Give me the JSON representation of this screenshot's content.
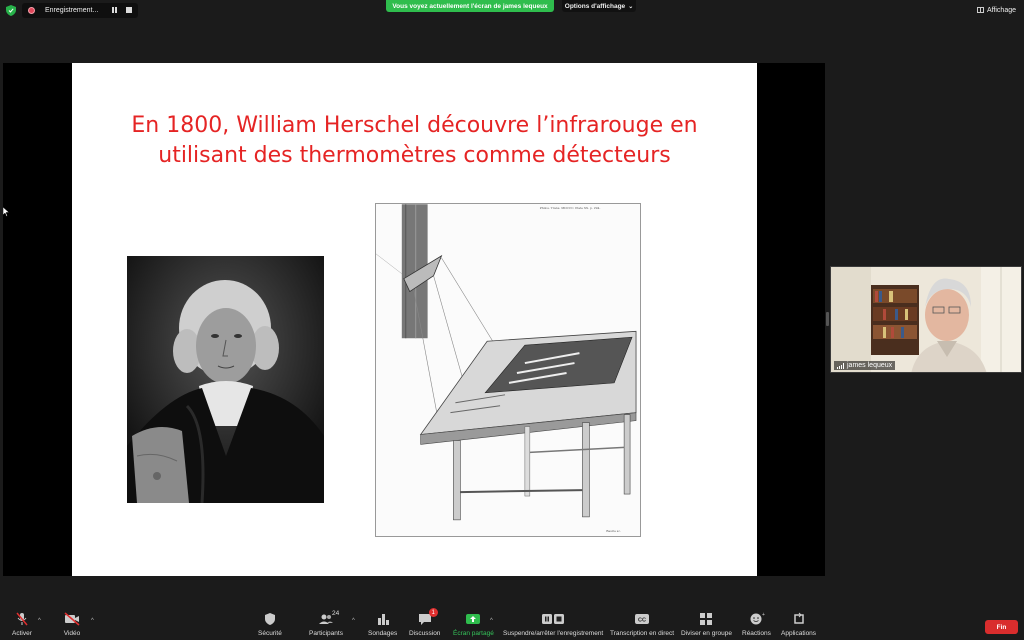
{
  "topbar": {
    "recording_label": "Enregistrement...",
    "share_banner": "Vous voyez actuellement l'écran de james lequeux",
    "view_options": "Options d'affichage",
    "view_label": "Affichage"
  },
  "slide": {
    "title_line1": "En 1800, William Herschel découvre l’infrarouge en",
    "title_line2": "utilisant des thermomètres comme détecteurs"
  },
  "participant": {
    "name": "james lequeux"
  },
  "toolbar": {
    "mute_label": "Activer",
    "video_label": "Vidéo",
    "security_label": "Sécurité",
    "participants_label": "Participants",
    "participants_count": "24",
    "polls_label": "Sondages",
    "chat_label": "Discussion",
    "chat_badge": "1",
    "share_label": "Écran partagé",
    "record_label": "Suspendre/arrêter l'enregistrement",
    "transcript_label": "Transcription en direct",
    "breakout_label": "Diviser en groupe",
    "reactions_label": "Réactions",
    "apps_label": "Applications",
    "end_label": "Fin"
  },
  "colors": {
    "share_banner": "#2fbd4d",
    "title_red": "#e52424",
    "end_button": "#d92d2d"
  }
}
